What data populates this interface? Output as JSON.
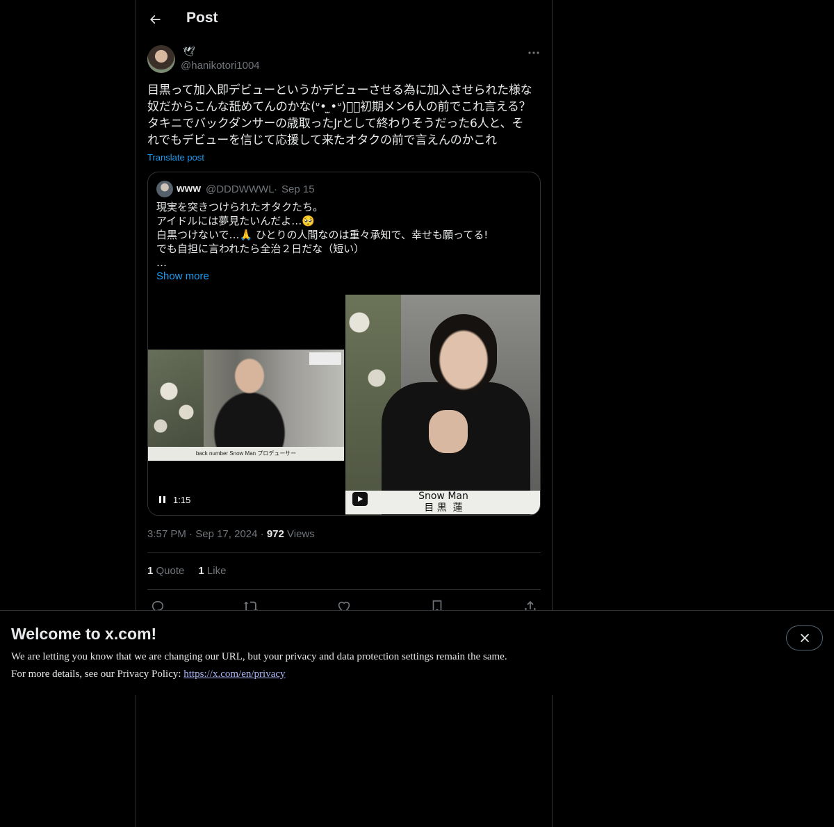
{
  "header": {
    "title": "Post"
  },
  "author": {
    "display_name": "🕊",
    "handle": "@hanikotori1004"
  },
  "post": {
    "text": "目黒って加入即デビューというかデビューさせる為に加入させられた様な\n奴だからこんな舐めてんのかな(ᐡ• ̫•ᐡ)ﾟﾟ初期メン6人の前でこれ言える？\nタキニでバックダンサーの歳取ったJrとして終わりそうだった6人と、そ\nれでもデビューを信じて応援して来たオタクの前で言えんのかこれ",
    "translate_label": "Translate post"
  },
  "quote": {
    "name": "www",
    "handle": "@DDDWWWL",
    "dot": "·",
    "date": "Sep 15",
    "text": "現実を突きつけられたオタクたち。\nアイドルには夢見たいんだよ…🥺\n白黒つけないで…🙏 ひとりの人間なのは重々承知で、幸せも願ってる!\nでも自担に言われたら全治２日だな（短い）\n…",
    "show_more": "Show more",
    "media": {
      "duration": "1:15",
      "left_caption": "back number   Snow Man   プロデューサー",
      "right_caption": "Snow Man\n目 黒  蓮"
    }
  },
  "meta": {
    "time": "3:57 PM",
    "sep1": "·",
    "date": "Sep 17, 2024",
    "sep2": "·",
    "views_count": "972",
    "views_label": "Views"
  },
  "stats": {
    "quotes_count": "1",
    "quotes_label": "Quote",
    "likes_count": "1",
    "likes_label": "Like"
  },
  "banner": {
    "title": "Welcome to x.com!",
    "line1": "We are letting you know that we are changing our URL, but your privacy and data protection settings remain the same.",
    "line2_prefix": "For more details, see our Privacy Policy: ",
    "link": "https://x.com/en/privacy"
  }
}
